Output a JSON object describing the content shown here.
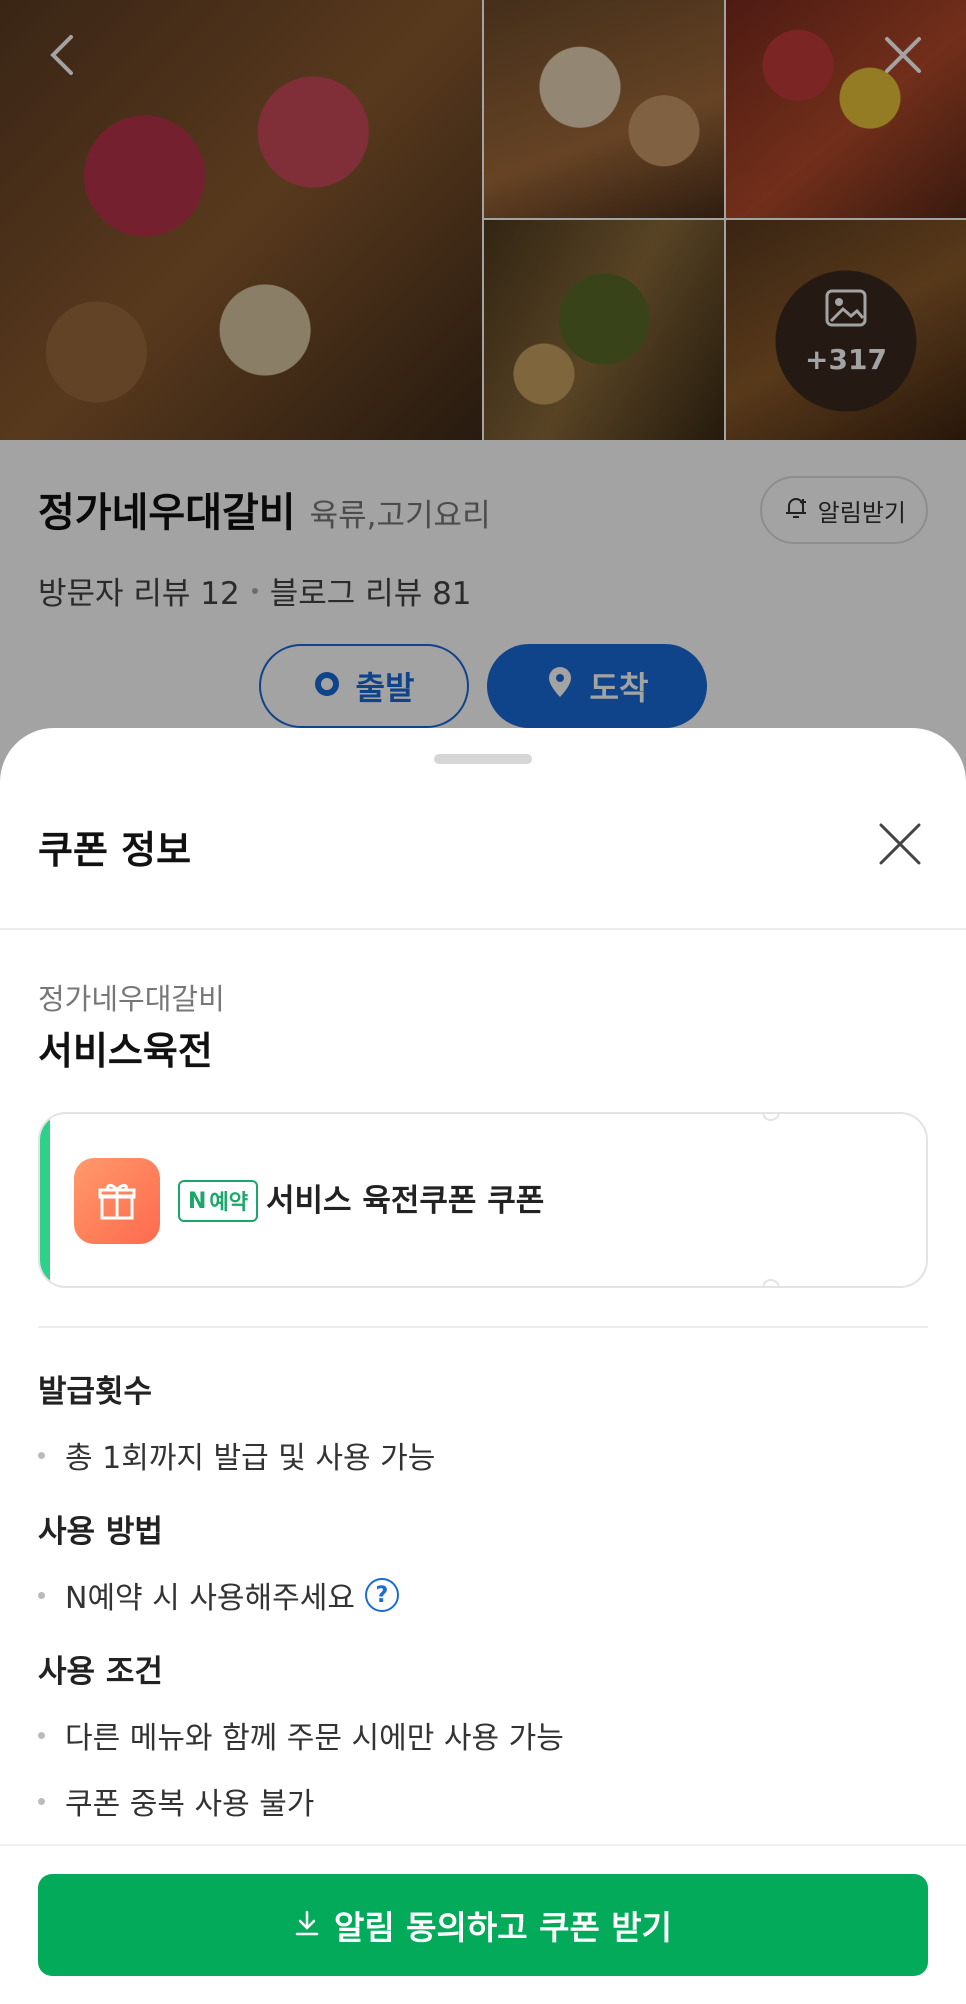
{
  "place": {
    "name": "정가네우대갈비",
    "category": "육류,고기요리",
    "alarm_label": "알림받기",
    "visitor_reviews": "방문자 리뷰 12",
    "blog_reviews": "블로그 리뷰 81",
    "depart_label": "출발",
    "arrive_label": "도착",
    "photo_more_count": "+317"
  },
  "sheet": {
    "title": "쿠폰 정보",
    "store_name": "정가네우대갈비",
    "coupon_name": "서비스육전",
    "coupon": {
      "badge_n": "N",
      "badge_text": "예약",
      "text": "서비스 육전쿠폰 쿠폰"
    },
    "sections": [
      {
        "title": "발급횟수",
        "items": [
          "총 1회까지 발급 및 사용 가능"
        ]
      },
      {
        "title": "사용 방법",
        "items": [
          "N예약 시 사용해주세요"
        ]
      },
      {
        "title": "사용 조건",
        "items": [
          "다른 메뉴와 함께 주문 시에만 사용 가능",
          "쿠폰 중복 사용 불가"
        ]
      }
    ],
    "help_glyph": "?",
    "cta_label": "알림 동의하고 쿠폰 받기"
  },
  "colors": {
    "accent_blue": "#1a6bd8",
    "cta_green": "#03aa5a",
    "coupon_stripe": "#2ed18a"
  },
  "icons": [
    "back-arrow-icon",
    "close-icon",
    "image-icon",
    "bell-icon",
    "origin-dot-icon",
    "location-pin-icon",
    "gift-icon",
    "help-icon",
    "download-icon"
  ]
}
